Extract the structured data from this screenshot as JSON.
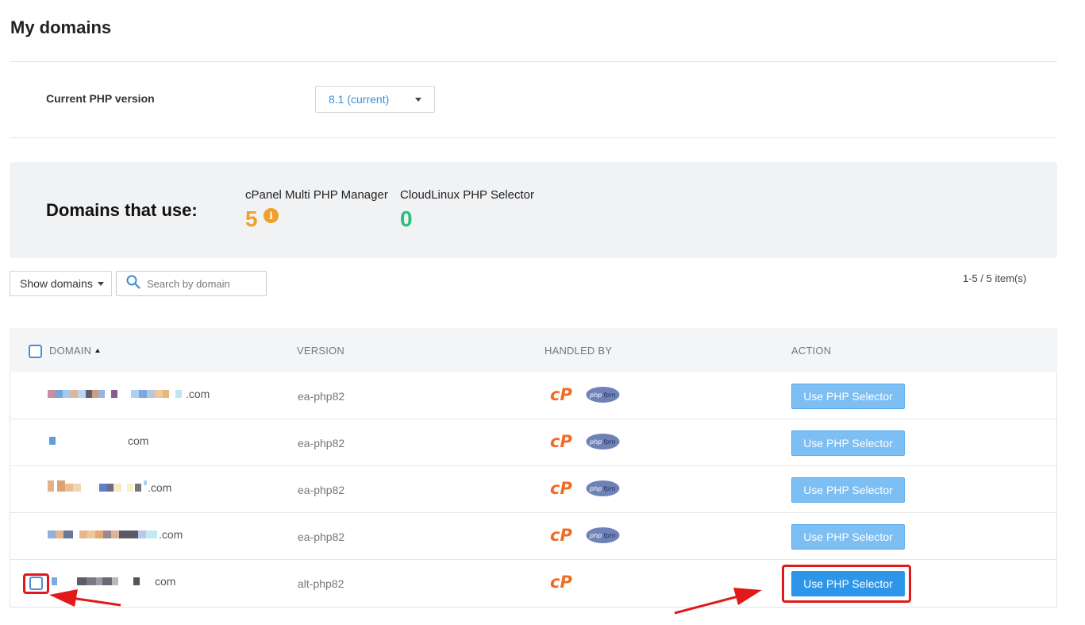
{
  "page": {
    "title": "My domains"
  },
  "php_version": {
    "label": "Current PHP version",
    "selected": "8.1 (current)"
  },
  "stats": {
    "heading": "Domains that use:",
    "cpanel": {
      "label": "cPanel Multi PHP Manager",
      "value": "5",
      "color": "#f0a02a",
      "info_icon": "i"
    },
    "cloudlinux": {
      "label": "CloudLinux PHP Selector",
      "value": "0",
      "color": "#2bbf7a"
    }
  },
  "toolbar": {
    "show_domains_label": "Show domains",
    "search_placeholder": "Search by domain",
    "items_count": "1-5 / 5 item(s)"
  },
  "table": {
    "headers": {
      "domain": "DOMAIN",
      "version": "VERSION",
      "handled_by": "HANDLED BY",
      "action": "ACTION"
    },
    "rows": [
      {
        "domain_suffix": ".com",
        "version": "ea-php82",
        "handlers": [
          "cpanel-icon",
          "php-fpm-icon"
        ],
        "action": "Use PHP Selector"
      },
      {
        "domain_suffix": "com",
        "version": "ea-php82",
        "handlers": [
          "cpanel-icon",
          "php-fpm-icon"
        ],
        "action": "Use PHP Selector"
      },
      {
        "domain_suffix": ".com",
        "version": "ea-php82",
        "handlers": [
          "cpanel-icon",
          "php-fpm-icon"
        ],
        "action": "Use PHP Selector"
      },
      {
        "domain_suffix": ".com",
        "version": "ea-php82",
        "handlers": [
          "cpanel-icon",
          "php-fpm-icon"
        ],
        "action": "Use PHP Selector"
      },
      {
        "domain_suffix": "com",
        "version": "alt-php82",
        "handlers": [
          "cpanel-icon"
        ],
        "action": "Use PHP Selector"
      }
    ]
  },
  "colors": {
    "accent": "#2d96eb",
    "button_light": "#7dbef3",
    "annotation": "#e01a1a"
  }
}
